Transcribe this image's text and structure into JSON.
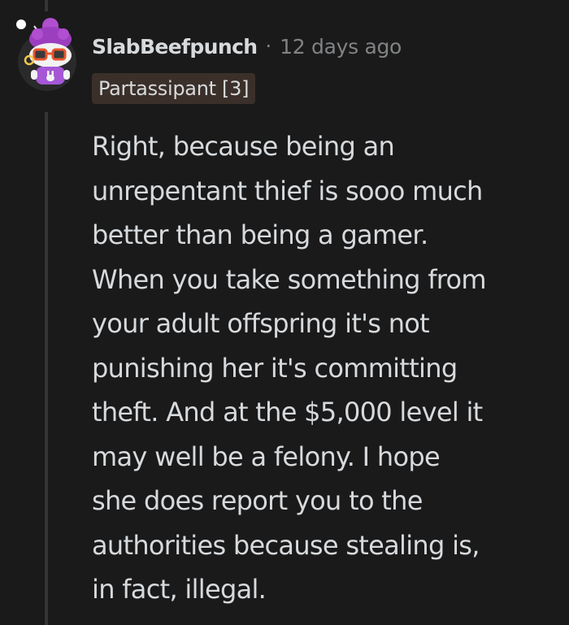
{
  "comment": {
    "author": "SlabBeefpunch",
    "separator": "·",
    "timestamp": "12 days ago",
    "flair": "Partassipant [3]",
    "body_lines": [
      "Right, because being an",
      "unrepentant thief is sooo much",
      "better than being a gamer.",
      "When you take something from",
      "your adult offspring it's not",
      "punishing her it's committing",
      "theft. And at the $5,000 level it",
      "may well be a felony. I hope",
      "she does report you to the",
      "authorities because stealing is,",
      "in fact, illegal."
    ]
  },
  "avatar": {
    "icon": "snoo-avatar-icon",
    "hair_color": "#9b3fbf",
    "shirt_color": "#a557d6",
    "glasses_color": "#e8542b"
  },
  "colors": {
    "background": "#1a1a1b",
    "text": "#d7dadc",
    "muted": "#818384",
    "flair_bg": "#3b2f2a",
    "thread_line": "#343536"
  }
}
